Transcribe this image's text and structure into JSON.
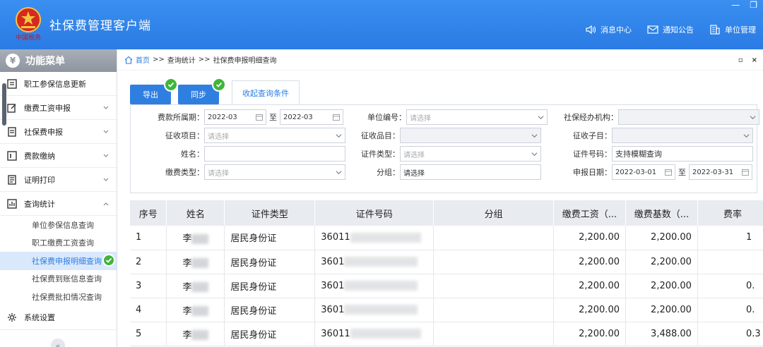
{
  "header": {
    "app_title": "社保费管理客户端",
    "logo_caption": "中国税务",
    "nav": [
      {
        "label": "消息中心",
        "icon": "speaker-icon"
      },
      {
        "label": "通知公告",
        "icon": "mail-icon"
      },
      {
        "label": "单位管理",
        "icon": "building-icon"
      }
    ]
  },
  "sidebar": {
    "title": "功能菜单",
    "items": [
      {
        "label": "职工参保信息更新"
      },
      {
        "label": "缴费工资申报"
      },
      {
        "label": "社保费申报"
      },
      {
        "label": "费款缴纳"
      },
      {
        "label": "证明打印"
      },
      {
        "label": "查询统计"
      }
    ],
    "submenu": [
      {
        "label": "单位参保信息查询"
      },
      {
        "label": "职工缴费工资查询"
      },
      {
        "label": "社保费申报明细查询"
      },
      {
        "label": "社保费到账信息查询"
      },
      {
        "label": "社保费批扣情况查询"
      }
    ],
    "settings": {
      "label": "系统设置"
    }
  },
  "breadcrumb": {
    "home": "首页",
    "sep": ">>",
    "level1": "查询统计",
    "level2": "社保费申报明细查询"
  },
  "toolbar": {
    "export_label": "导出",
    "sync_label": "同步",
    "toggle_label": "收起查询条件"
  },
  "filters": {
    "period_label": "费款所属期：",
    "period_from": "2022-03",
    "period_to": "2022-03",
    "to_label": "至",
    "unit_no_label": "单位编号：",
    "unit_no_placeholder": "请选择",
    "agency_label": "社保经办机构：",
    "agency_value": "",
    "item_label": "征收项目：",
    "item_placeholder": "请选择",
    "grade_label": "征收品目：",
    "grade_value": "",
    "subitem_label": "征收子目：",
    "subitem_value": "",
    "name_label": "姓名：",
    "name_value": "",
    "idtype_label": "证件类型：",
    "idtype_placeholder": "请选择",
    "idno_label": "证件号码：",
    "idno_placeholder": "支持模糊查询",
    "paytype_label": "缴费类型：",
    "paytype_placeholder": "请选择",
    "group_label": "分组：",
    "group_placeholder": "请选择",
    "date_label": "申报日期：",
    "date_from": "2022-03-01",
    "date_to": "2022-03-31"
  },
  "table": {
    "columns": [
      "序号",
      "姓名",
      "证件类型",
      "证件号码",
      "分组",
      "缴费工资（...",
      "缴费基数（...",
      "费率"
    ],
    "rows": [
      {
        "no": "1",
        "name": "李",
        "idtype": "居民身份证",
        "idno": "36011",
        "group": "",
        "wage": "2,200.00",
        "base": "2,200.00",
        "rate": "1"
      },
      {
        "no": "2",
        "name": "李",
        "idtype": "居民身份证",
        "idno": "3601",
        "group": "",
        "wage": "2,200.00",
        "base": "2,200.00",
        "rate": ""
      },
      {
        "no": "3",
        "name": "李",
        "idtype": "居民身份证",
        "idno": "3601",
        "group": "",
        "wage": "2,200.00",
        "base": "2,200.00",
        "rate": "0."
      },
      {
        "no": "4",
        "name": "李",
        "idtype": "居民身份证",
        "idno": "3601",
        "group": "",
        "wage": "2,200.00",
        "base": "2,200.00",
        "rate": "0."
      },
      {
        "no": "5",
        "name": "李",
        "idtype": "居民身份证",
        "idno": "36011",
        "group": "",
        "wage": "2,200.00",
        "base": "3,488.00",
        "rate": "0.3"
      }
    ]
  }
}
